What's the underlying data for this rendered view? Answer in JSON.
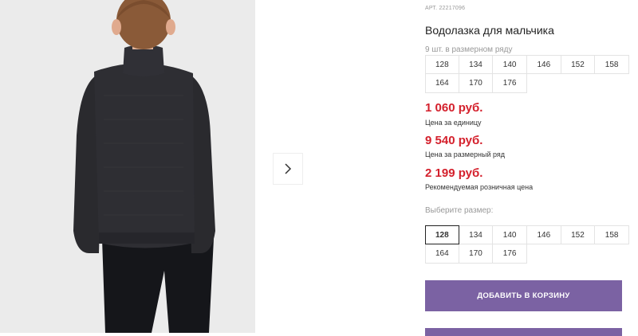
{
  "product": {
    "article_prefix": "АРТ.",
    "article": "22217096",
    "title": "Водолазка для мальчика",
    "pack_label": "9 шт. в размерном ряду"
  },
  "pack_sizes": [
    "128",
    "134",
    "140",
    "146",
    "152",
    "158",
    "164",
    "170",
    "176"
  ],
  "prices": {
    "unit_price": "1 060 руб.",
    "unit_note": "Цена за единицу",
    "pack_price": "9 540 руб.",
    "pack_note": "Цена за размерный ряд",
    "retail_price": "2 199 руб.",
    "retail_note": "Рекомендуемая розничная цена"
  },
  "size_selector": {
    "label": "Выберите размер:",
    "sizes": [
      "128",
      "134",
      "140",
      "146",
      "152",
      "158",
      "164",
      "170",
      "176"
    ],
    "selected": "128"
  },
  "buttons": {
    "add_to_cart": "ДОБАВИТЬ В КОРЗИНУ"
  },
  "icons": {
    "next": "chevron-right-icon"
  },
  "colors": {
    "price": "#d4202c",
    "button": "#7b62a3",
    "sweater": "#2b2b2f"
  }
}
